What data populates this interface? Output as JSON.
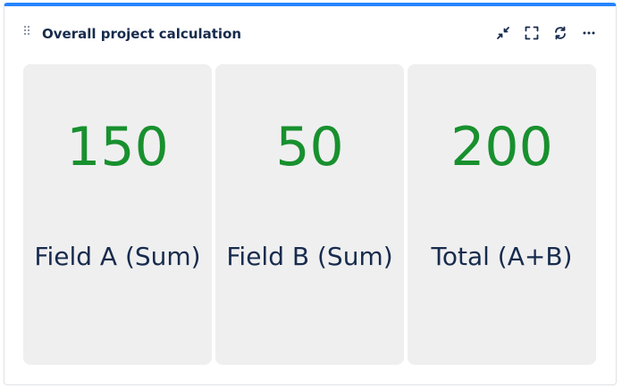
{
  "gadget": {
    "title": "Overall project calculation",
    "accent_color": "#2684ff",
    "value_color": "#18902e",
    "actions": [
      {
        "name": "minimize",
        "icon": "minimize-icon"
      },
      {
        "name": "fullscreen",
        "icon": "fullscreen-icon"
      },
      {
        "name": "refresh",
        "icon": "refresh-icon"
      },
      {
        "name": "more",
        "icon": "more-icon"
      }
    ]
  },
  "tiles": [
    {
      "value": "150",
      "label": "Field A (Sum)"
    },
    {
      "value": "50",
      "label": "Field B (Sum)"
    },
    {
      "value": "200",
      "label": "Total (A+B)"
    }
  ]
}
